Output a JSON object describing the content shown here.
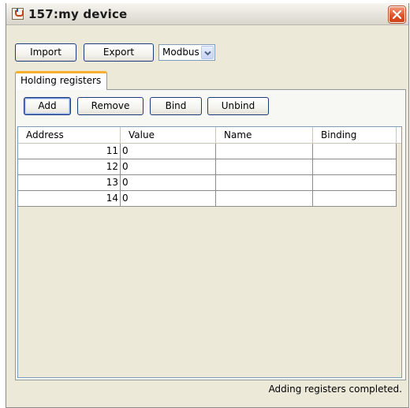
{
  "window": {
    "title": "157:my device",
    "icon": "java-cup-icon"
  },
  "toolbar": {
    "import_label": "Import",
    "export_label": "Export",
    "protocol_selected": "Modbus"
  },
  "tabs": [
    {
      "label": "Holding registers",
      "active": true
    }
  ],
  "actions": {
    "add_label": "Add",
    "remove_label": "Remove",
    "bind_label": "Bind",
    "unbind_label": "Unbind"
  },
  "table": {
    "columns": [
      "Address",
      "Value",
      "Name",
      "Binding"
    ],
    "rows": [
      {
        "address": "11",
        "value": "0",
        "name": "",
        "binding": ""
      },
      {
        "address": "12",
        "value": "0",
        "name": "",
        "binding": ""
      },
      {
        "address": "13",
        "value": "0",
        "name": "",
        "binding": ""
      },
      {
        "address": "14",
        "value": "0",
        "name": "",
        "binding": ""
      }
    ]
  },
  "status": {
    "message": "Adding registers completed."
  },
  "colors": {
    "window_bg": "#ece9d8",
    "tab_accent": "#f6b02d",
    "close_button": "#e0542c"
  }
}
